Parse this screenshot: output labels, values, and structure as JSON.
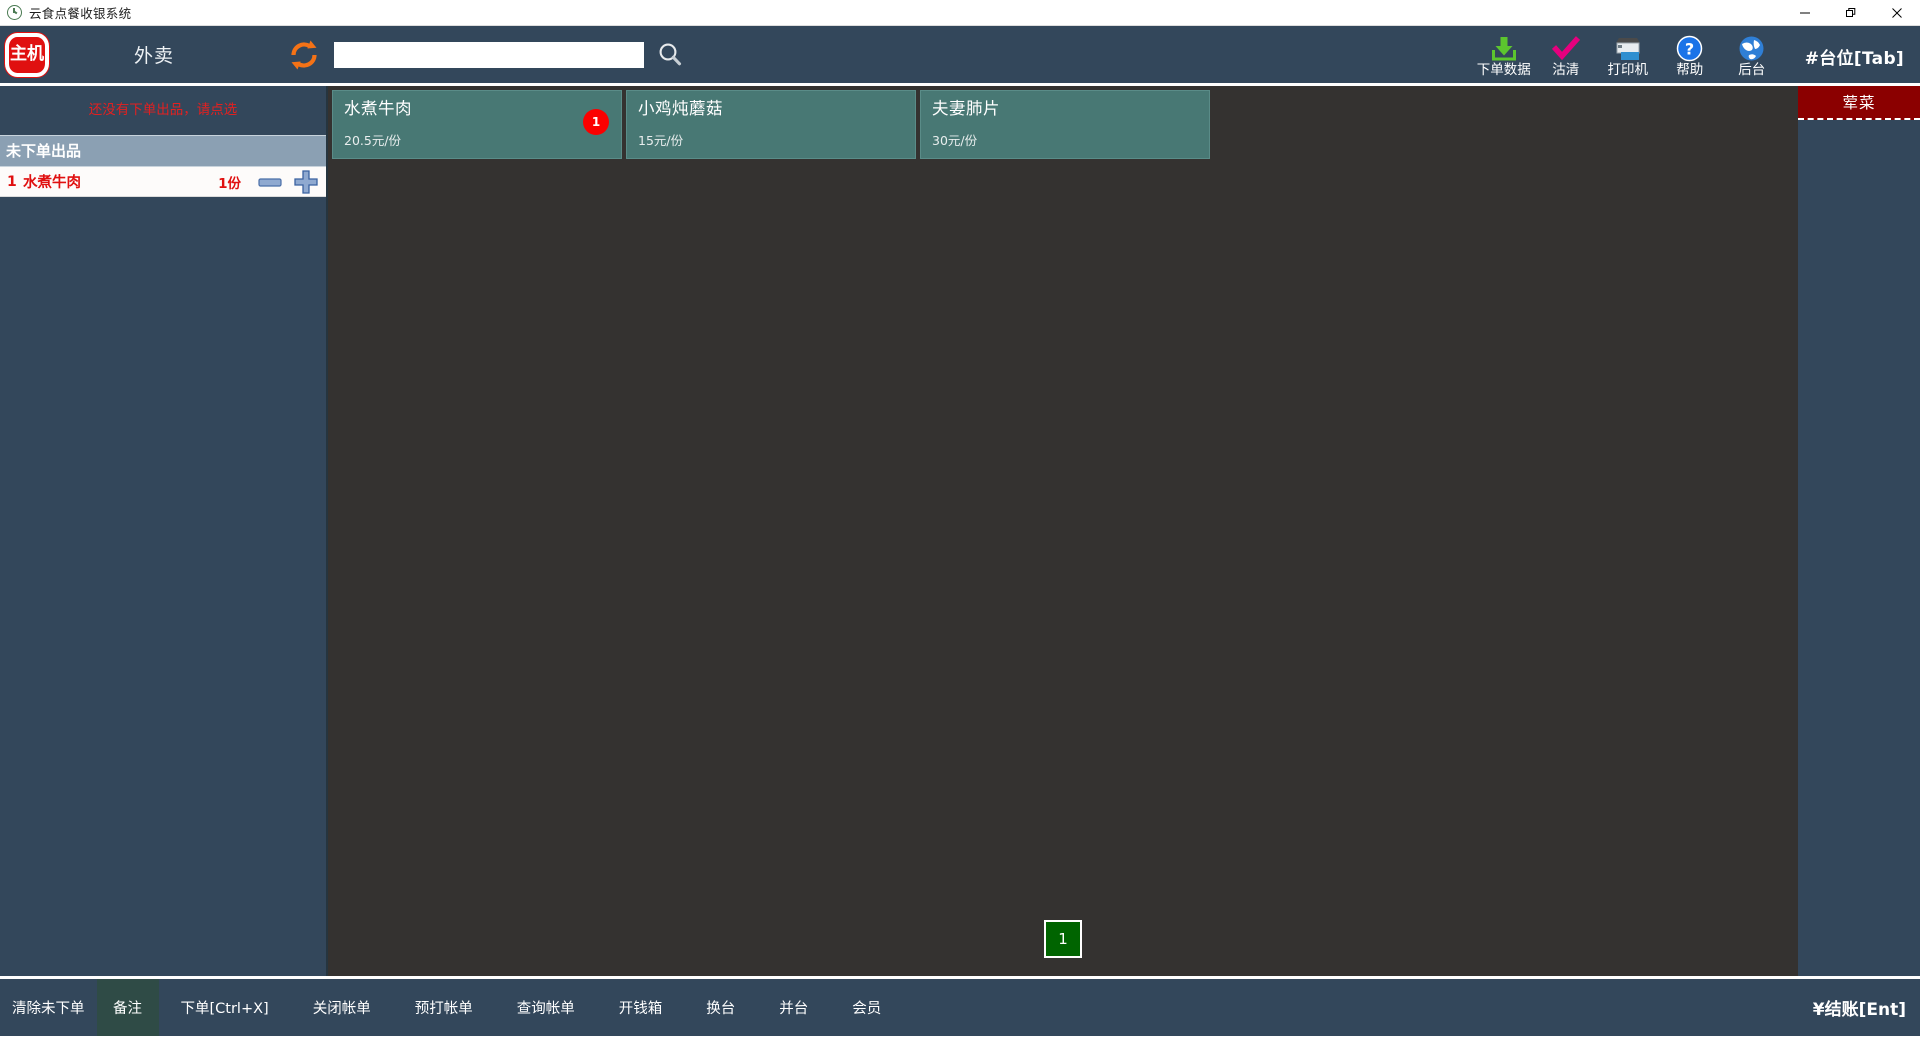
{
  "window": {
    "title": "云食点餐收银系统",
    "app_icon": "clock-icon",
    "minimize_label": "—",
    "restore_label": "❐",
    "close_label": "✕"
  },
  "topbar": {
    "host_badge": "主机",
    "mode_label": "外卖",
    "refresh_icon": "refresh-icon",
    "search_value": "",
    "search_placeholder": "",
    "search_icon": "search-icon",
    "station_label": "#台位[Tab]",
    "tools": [
      {
        "label": "下单数据",
        "icon": "download-icon",
        "color": "#5cc62e"
      },
      {
        "label": "沽清",
        "icon": "check-icon",
        "color": "#e6007e"
      },
      {
        "label": "打印机",
        "icon": "printer-icon",
        "color": "#dfe6ec"
      },
      {
        "label": "帮助",
        "icon": "question-icon",
        "color": "#1a73e8"
      },
      {
        "label": "后台",
        "icon": "globe-icon",
        "color": "#1a73e8"
      }
    ]
  },
  "order_panel": {
    "notice": "还没有下单出品，请点选",
    "section_header": "未下单出品",
    "rows": [
      {
        "index": "1",
        "name": "水煮牛肉",
        "qty": "1份",
        "minus_icon": "minus-icon",
        "plus_icon": "plus-icon"
      }
    ]
  },
  "menu": {
    "dishes": [
      {
        "name": "水煮牛肉",
        "price": "20.5元/份",
        "badge": "1"
      },
      {
        "name": "小鸡炖蘑菇",
        "price": "15元/份",
        "badge": ""
      },
      {
        "name": "夫妻肺片",
        "price": "30元/份",
        "badge": ""
      }
    ],
    "pages": [
      "1"
    ]
  },
  "categories": [
    {
      "label": "荤菜",
      "color": "#8b0000"
    }
  ],
  "bottombar": {
    "buttons": [
      {
        "label": "清除未下单",
        "active": false
      },
      {
        "label": "备注",
        "active": true
      },
      {
        "label": "下单[Ctrl+X]",
        "active": false
      },
      {
        "label": "关闭帐单",
        "active": false
      },
      {
        "label": "预打帐单",
        "active": false
      },
      {
        "label": "查询帐单",
        "active": false
      },
      {
        "label": "开钱箱",
        "active": false
      },
      {
        "label": "换台",
        "active": false
      },
      {
        "label": "并台",
        "active": false
      },
      {
        "label": "会员",
        "active": false
      }
    ],
    "settle_label": "¥结账[Ent]"
  }
}
